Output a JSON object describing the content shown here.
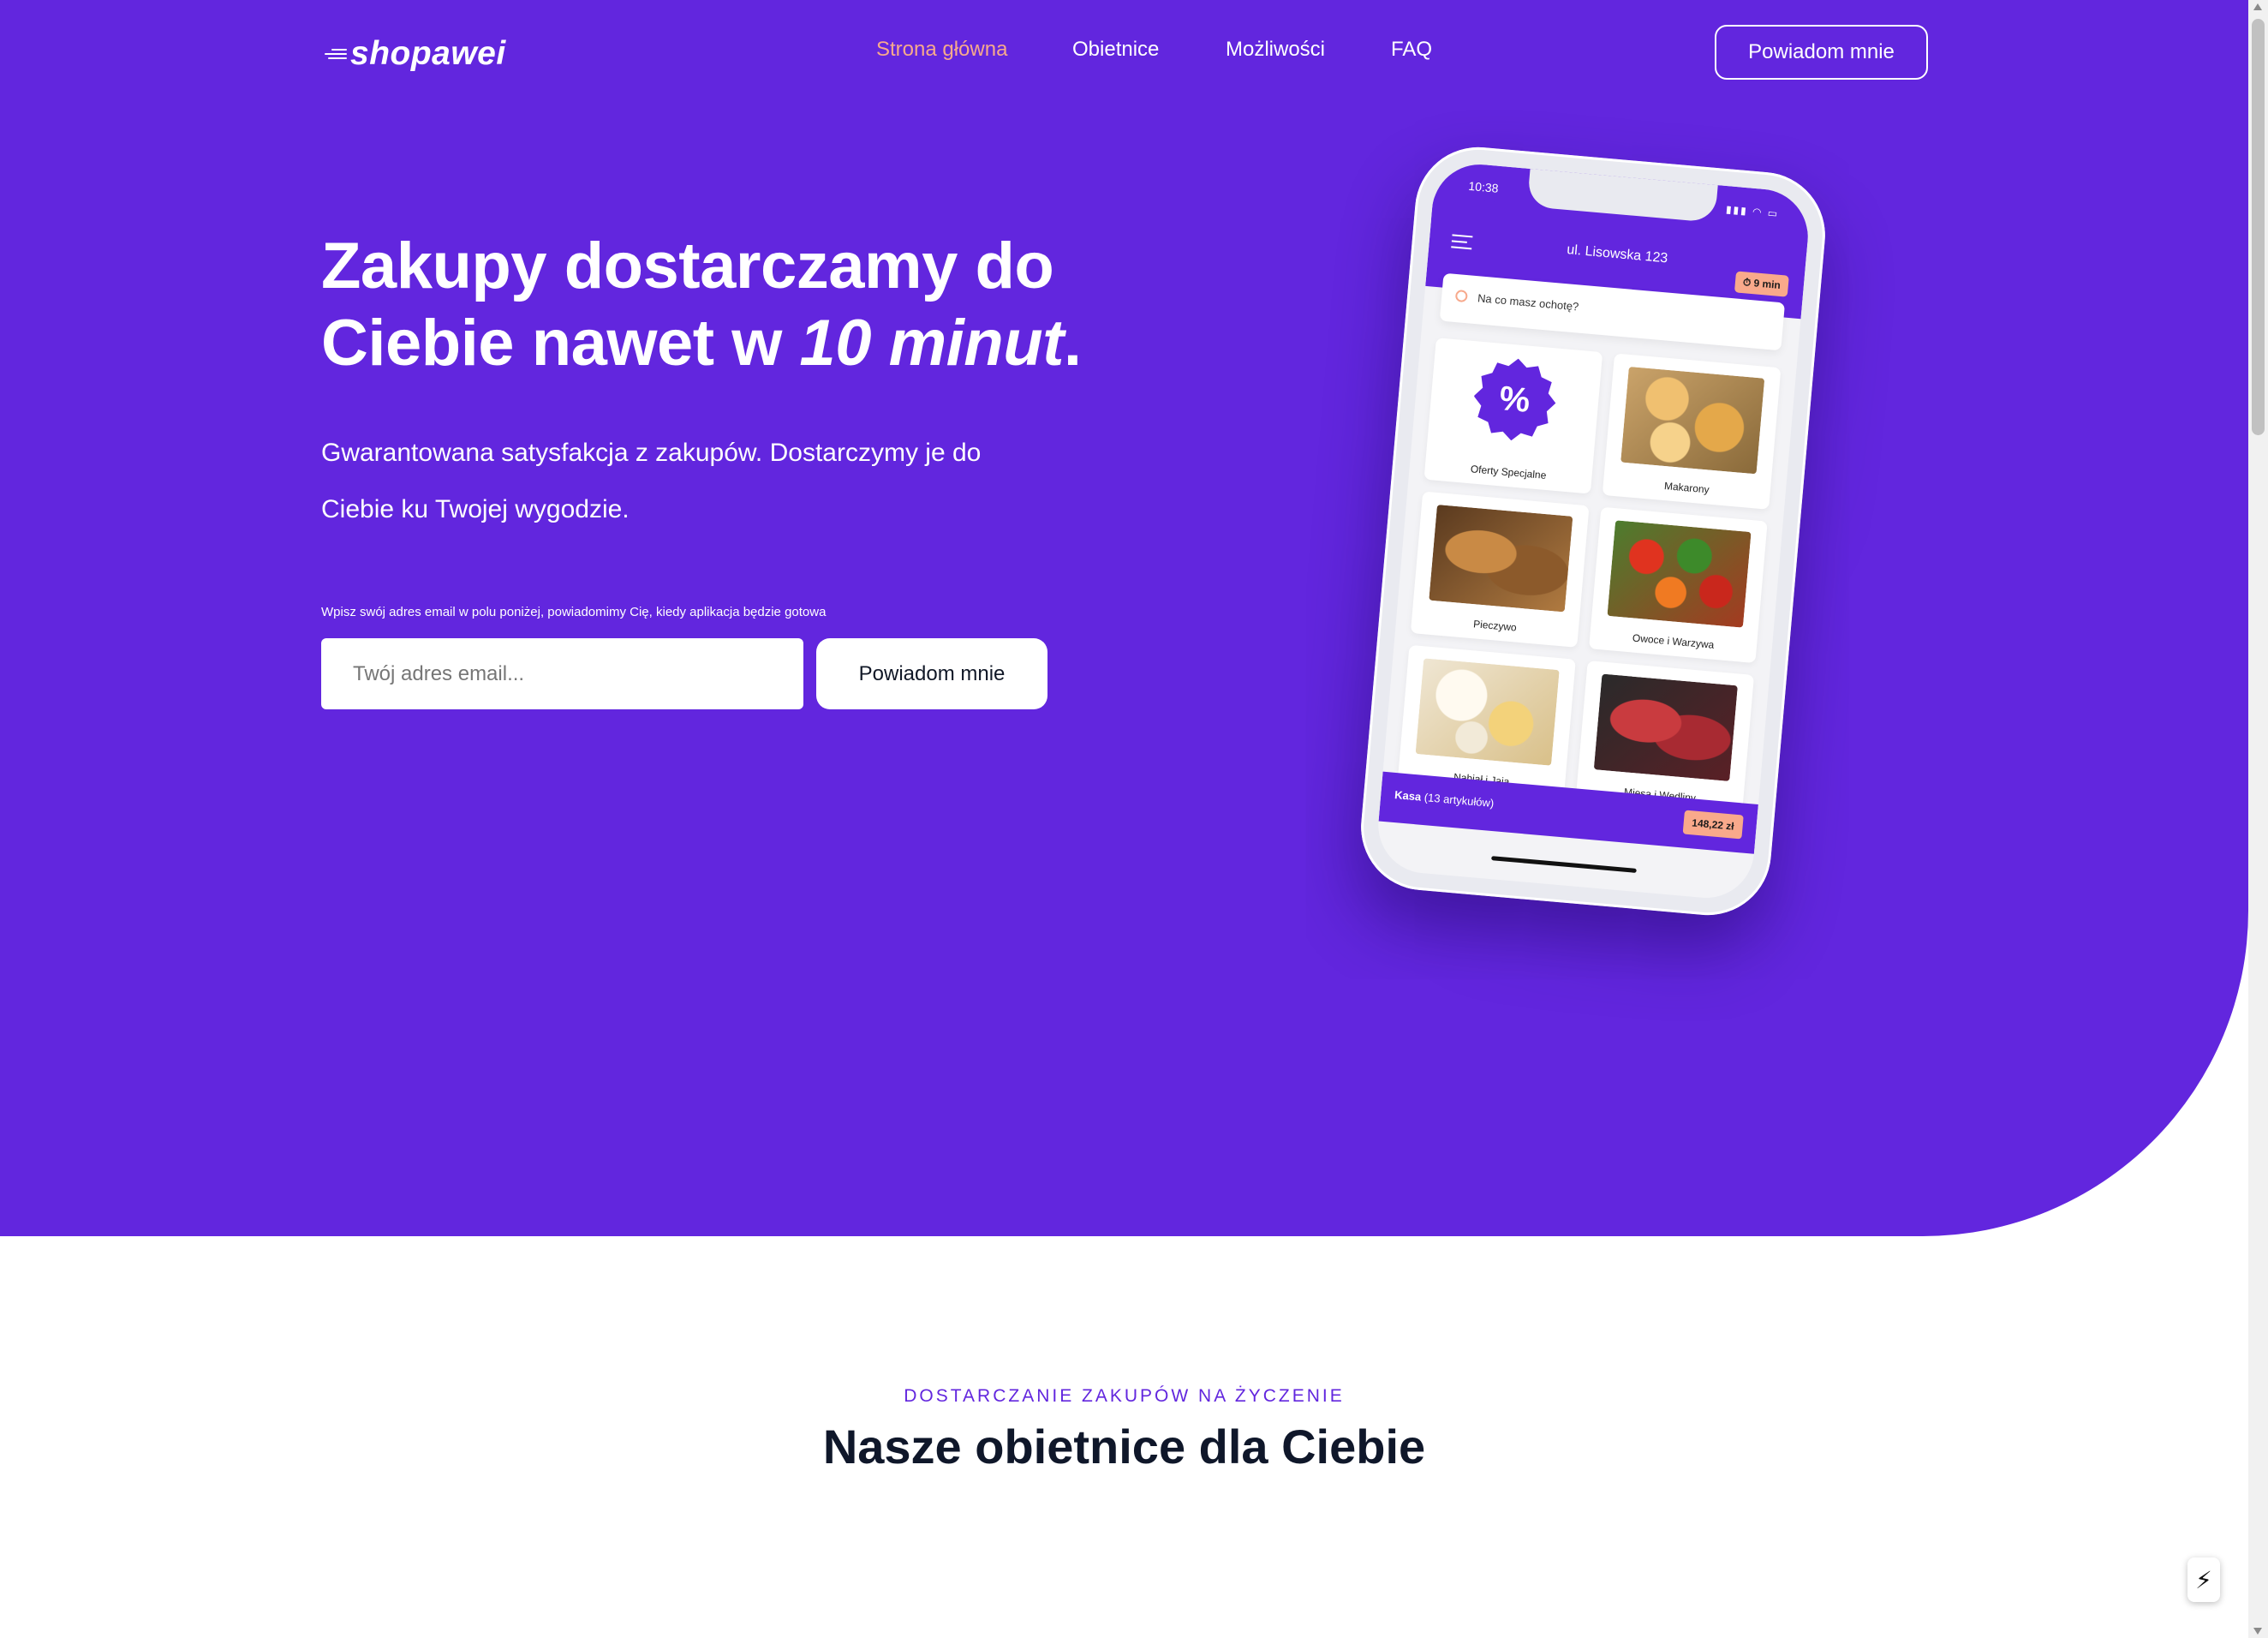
{
  "brand": {
    "name": "shopawei",
    "icon": "speed-lines-icon"
  },
  "colors": {
    "primary": "#6226de",
    "accent": "#f7a98c",
    "dark_text": "#0f172a"
  },
  "nav": {
    "items": [
      {
        "label": "Strona główna",
        "active": true
      },
      {
        "label": "Obietnice",
        "active": false
      },
      {
        "label": "Możliwości",
        "active": false
      },
      {
        "label": "FAQ",
        "active": false
      }
    ],
    "cta_label": "Powiadom mnie"
  },
  "hero": {
    "title_part1": "Zakupy dostarczamy do Ciebie nawet w ",
    "title_emphasis": "10 minut",
    "title_end": ".",
    "subtitle": "Gwarantowana satysfakcja z zakupów. Dostarczymy je do Ciebie ku Twojej wygodzie.",
    "hint": "Wpisz swój adres email w polu poniżej, powiadomimy Cię, kiedy aplikacja będzie gotowa",
    "email_placeholder": "Twój adres email...",
    "submit_label": "Powiadom mnie"
  },
  "phone": {
    "time": "10:38",
    "status_icons": "signal-wifi-battery-icons",
    "address": "ul. Lisowska 123",
    "eta": "⏱ 9 min",
    "search_placeholder": "Na co masz ochotę?",
    "categories": [
      {
        "label": "Oferty Specjalne",
        "icon": "percent-badge-icon"
      },
      {
        "label": "Makarony",
        "icon": "pasta-image"
      },
      {
        "label": "Pieczywo",
        "icon": "bread-image"
      },
      {
        "label": "Owoce i Warzywa",
        "icon": "vegetables-image"
      },
      {
        "label": "Nabiał i Jaja",
        "icon": "dairy-image"
      },
      {
        "label": "Mięsa i Wędliny",
        "icon": "meat-image"
      }
    ],
    "checkout_label": "Kasa",
    "checkout_count": "(13 artykułów)",
    "checkout_total": "148,22 zł"
  },
  "section": {
    "eyebrow": "DOSTARCZANIE ZAKUPÓW NA ŻYCZENIE",
    "title": "Nasze obietnice dla Ciebie"
  },
  "floating_button_icon": "lightning-bolt-icon"
}
